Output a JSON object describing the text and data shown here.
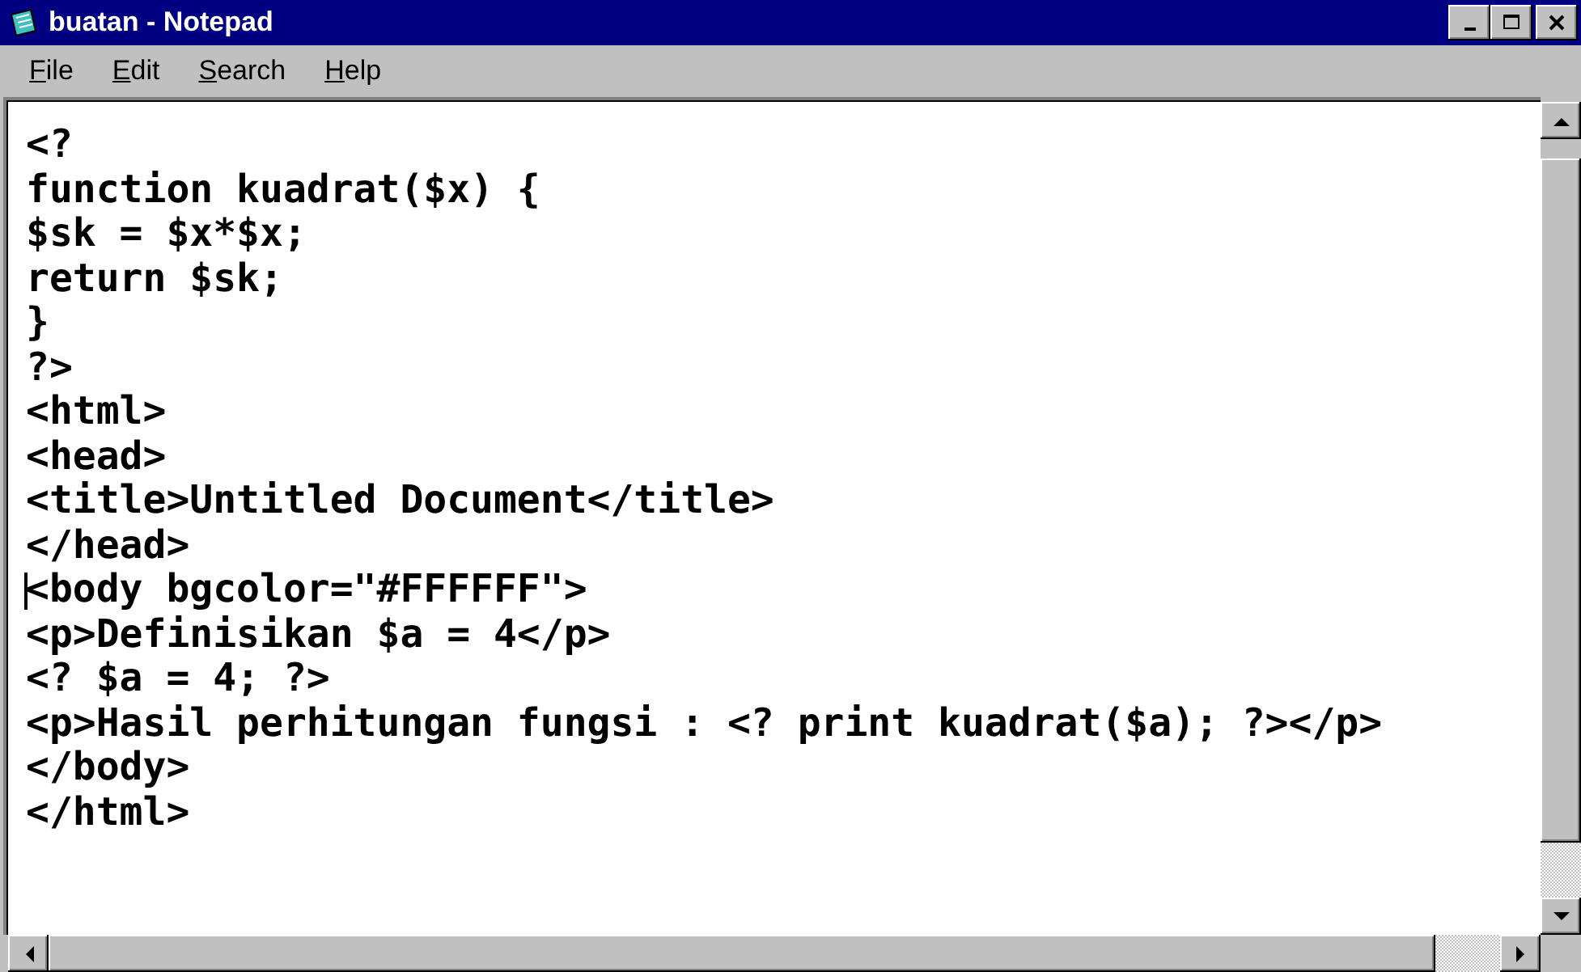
{
  "window": {
    "title": "buatan - Notepad"
  },
  "menu": [
    "File",
    "Edit",
    "Search",
    "Help"
  ],
  "editor": {
    "lines": [
      {
        "text": "<?",
        "cursor": false
      },
      {
        "text": "function kuadrat($x) {",
        "cursor": false
      },
      {
        "text": "$sk = $x*$x;",
        "cursor": false
      },
      {
        "text": "return $sk;",
        "cursor": false
      },
      {
        "text": "}",
        "cursor": false
      },
      {
        "text": "?>",
        "cursor": false
      },
      {
        "text": "<html>",
        "cursor": false
      },
      {
        "text": "<head>",
        "cursor": false
      },
      {
        "text": "<title>Untitled Document</title>",
        "cursor": false
      },
      {
        "text": "</head>",
        "cursor": false
      },
      {
        "text": "<body bgcolor=\"#FFFFFF\">",
        "cursor": true
      },
      {
        "text": "<p>Definisikan $a = 4</p>",
        "cursor": false
      },
      {
        "text": "<? $a = 4; ?>",
        "cursor": false
      },
      {
        "text": "<p>Hasil perhitungan fungsi : <? print kuadrat($a); ?></p>",
        "cursor": false
      },
      {
        "text": "</body>",
        "cursor": false
      },
      {
        "text": "</html>",
        "cursor": false
      }
    ]
  }
}
